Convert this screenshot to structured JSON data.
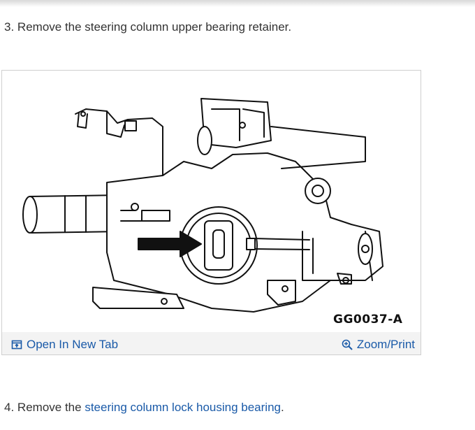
{
  "steps": [
    {
      "number": "3.",
      "text": "Remove the steering column upper bearing retainer."
    },
    {
      "number": "4.",
      "text_before": "Remove the ",
      "link_text": "steering column lock housing bearing",
      "text_after": "."
    }
  ],
  "figure": {
    "caption": "GG0037-A",
    "open_in_new_tab_label": "Open In New Tab",
    "zoom_print_label": "Zoom/Print",
    "icons": [
      "open-new-tab-icon",
      "zoom-magnifier-icon"
    ],
    "link_color": "#1a5aa8"
  }
}
